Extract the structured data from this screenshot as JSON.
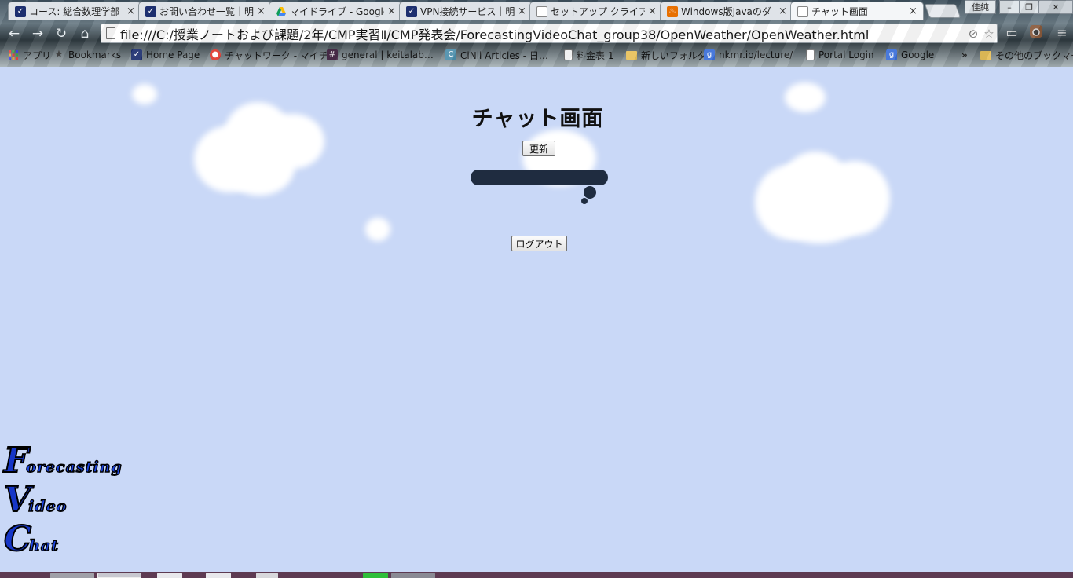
{
  "browser": {
    "tabs": [
      {
        "title": "コース: 総合数理学部",
        "icon": "v-mark-icon",
        "active": false
      },
      {
        "title": "お問い合わせ一覧｜明",
        "icon": "v-mark-icon",
        "active": false
      },
      {
        "title": "マイドライブ - Google",
        "icon": "drive-icon",
        "active": false
      },
      {
        "title": "VPN接続サービス｜明",
        "icon": "v-mark-icon",
        "active": false
      },
      {
        "title": "セットアップ クライアント",
        "icon": "page-icon",
        "active": false
      },
      {
        "title": "Windows版Javaのダ",
        "icon": "java-icon",
        "active": false
      },
      {
        "title": "チャット画面",
        "icon": "page-icon",
        "active": true
      }
    ],
    "profile_name": "佳純",
    "window_controls": {
      "minimize": "–",
      "restore": "❐",
      "close": "✕"
    },
    "url": "file:///C:/授業ノートおよび課題/2年/CMP実習Ⅱ/CMP発表会/ForecastingVideoChat_group38/OpenWeather/OpenWeather.html",
    "bookmarks": [
      {
        "label": "アプリ",
        "icon": "apps-grid-icon"
      },
      {
        "label": "Bookmarks",
        "icon": "star-icon"
      },
      {
        "label": "Home Page",
        "icon": "v-mark-icon"
      },
      {
        "label": "チャットワーク - マイチ…",
        "icon": "chatwork-icon"
      },
      {
        "label": "general | keitalab…",
        "icon": "slack-icon"
      },
      {
        "label": "CiNii Articles - 日…",
        "icon": "cinii-icon"
      },
      {
        "label": "料金表 1",
        "icon": "page-icon"
      },
      {
        "label": "新しいフォルダ",
        "icon": "folder-icon"
      },
      {
        "label": "nkmr.io/lecture/",
        "icon": "google-icon"
      },
      {
        "label": "Portal Login",
        "icon": "page-icon"
      },
      {
        "label": "Google",
        "icon": "google-icon"
      },
      {
        "label": "»",
        "icon": ""
      },
      {
        "label": "その他のブックマーク",
        "icon": "folder-icon"
      }
    ]
  },
  "page": {
    "title": "チャット画面",
    "refresh_button": "更新",
    "logout_button": "ログアウト",
    "logo": [
      {
        "cap": "F",
        "rest": "orecasting"
      },
      {
        "cap": "V",
        "rest": "ideo"
      },
      {
        "cap": "C",
        "rest": "hat"
      }
    ]
  },
  "colors": {
    "page_background": "#c9d8f7",
    "chat_bar": "#1f2c40",
    "logo_blue": "#1636c7"
  }
}
